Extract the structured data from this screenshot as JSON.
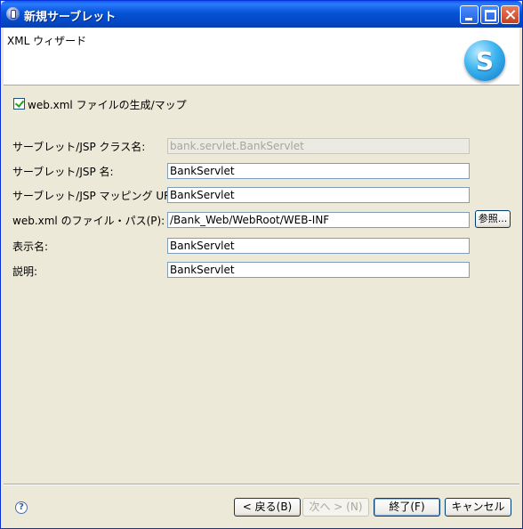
{
  "window": {
    "title": "新規サーブレット"
  },
  "banner": {
    "title": "XML ウィザード",
    "logo_letter": "S"
  },
  "options": {
    "generate_webxml_label": "web.xml ファイルの生成/マップ",
    "generate_webxml_checked": true
  },
  "form": {
    "class_name_label": "サーブレット/JSP クラス名:",
    "class_name_value": "bank.servlet.BankServlet",
    "servlet_name_label": "サーブレット/JSP 名:",
    "servlet_name_value": "BankServlet",
    "mapping_url_label": "サーブレット/JSP マッピング URL:",
    "mapping_url_value": "BankServlet",
    "webxml_path_label": "web.xml のファイル・パス(P):",
    "webxml_path_value": "/Bank_Web/WebRoot/WEB-INF",
    "browse_label": "参照...",
    "display_name_label": "表示名:",
    "display_name_value": "BankServlet",
    "description_label": "説明:",
    "description_value": "BankServlet"
  },
  "buttons": {
    "help_label": "?",
    "back_label": "< 戻る(B)",
    "next_label": "次へ > (N)",
    "finish_label": "終了(F)",
    "cancel_label": "キャンセル"
  }
}
